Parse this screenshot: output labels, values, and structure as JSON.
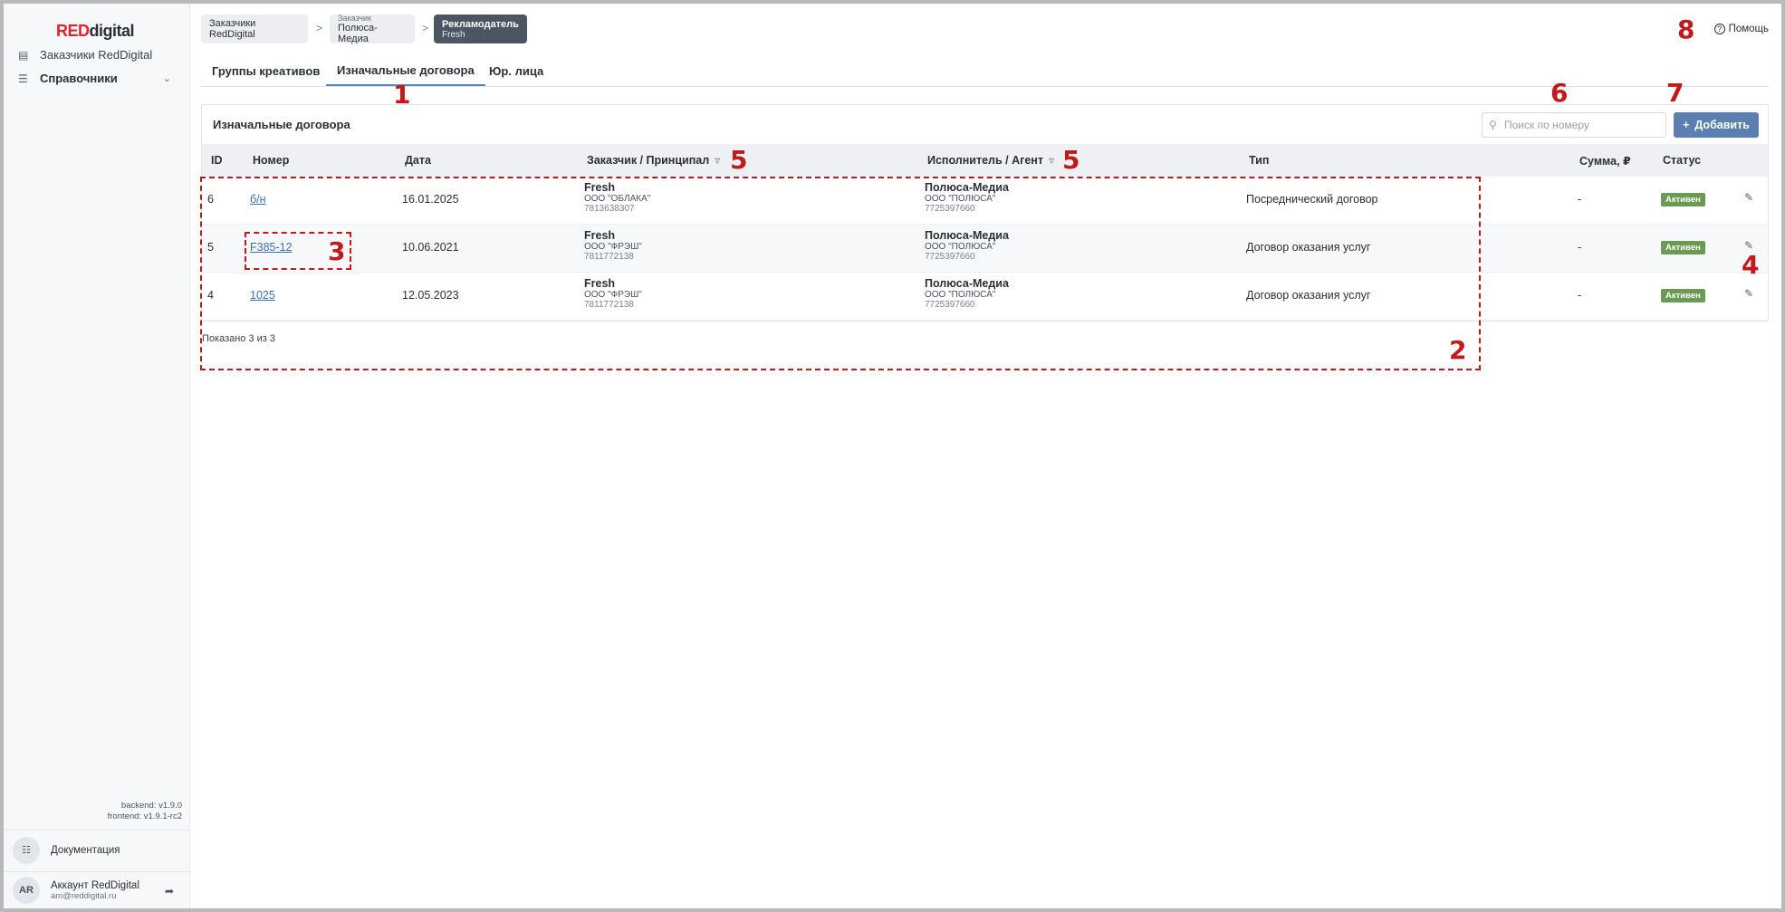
{
  "sidebar": {
    "logo_red": "RED",
    "logo_rest": "digital",
    "items": [
      {
        "label": "Заказчики RedDigital"
      },
      {
        "label": "Справочники"
      }
    ],
    "version_backend": "backend: v1.9.0",
    "version_frontend": "frontend: v1.9.1-rc2",
    "docs_label": "Документация",
    "account": {
      "initials": "AR",
      "name": "Аккаунт RedDigital",
      "email": "am@reddigital.ru"
    }
  },
  "breadcrumbs": [
    {
      "label": "Заказчики RedDigital"
    },
    {
      "small": "Заказчик",
      "label": "Полюса-Медиа"
    },
    {
      "label": "Рекламодатель",
      "small": "Fresh"
    }
  ],
  "help_label": "Помощь",
  "tabs": [
    {
      "label": "Группы креативов"
    },
    {
      "label": "Изначальные договора",
      "active": true
    },
    {
      "label": "Юр. лица"
    }
  ],
  "card": {
    "title": "Изначальные договора",
    "search_placeholder": "Поиск по номеру",
    "add_label": "Добавить"
  },
  "table": {
    "headers": {
      "id": "ID",
      "number": "Номер",
      "date": "Дата",
      "customer": "Заказчик / Принципал",
      "executor": "Исполнитель / Агент",
      "type": "Тип",
      "sum": "Сумма, ₽",
      "status": "Статус"
    },
    "rows": [
      {
        "id": "6",
        "number": "б/н",
        "date": "16.01.2025",
        "customer": {
          "name": "Fresh",
          "org": "ООО \"ОБЛАКА\"",
          "inn": "7813638307"
        },
        "executor": {
          "name": "Полюса-Медиа",
          "org": "ООО \"ПОЛЮСА\"",
          "inn": "7725397660"
        },
        "type": "Посреднический договор",
        "sum": "-",
        "status": "Активен"
      },
      {
        "id": "5",
        "number": "F385-12",
        "date": "10.06.2021",
        "customer": {
          "name": "Fresh",
          "org": "ООО \"ФРЭШ\"",
          "inn": "7811772138"
        },
        "executor": {
          "name": "Полюса-Медиа",
          "org": "ООО \"ПОЛЮСА\"",
          "inn": "7725397660"
        },
        "type": "Договор оказания услуг",
        "sum": "-",
        "status": "Активен"
      },
      {
        "id": "4",
        "number": "1025",
        "date": "12.05.2023",
        "customer": {
          "name": "Fresh",
          "org": "ООО \"ФРЭШ\"",
          "inn": "7811772138"
        },
        "executor": {
          "name": "Полюса-Медиа",
          "org": "ООО \"ПОЛЮСА\"",
          "inn": "7725397660"
        },
        "type": "Договор оказания услуг",
        "sum": "-",
        "status": "Активен"
      }
    ],
    "shown_text": "Показано 3 из 3"
  },
  "annotations": [
    "1",
    "2",
    "3",
    "4",
    "5",
    "5",
    "6",
    "7",
    "8"
  ],
  "colors": {
    "accent": "#5b7fae",
    "brand_red": "#e0242b",
    "status_active": "#6a9a54",
    "annotation": "#c01a1a"
  }
}
